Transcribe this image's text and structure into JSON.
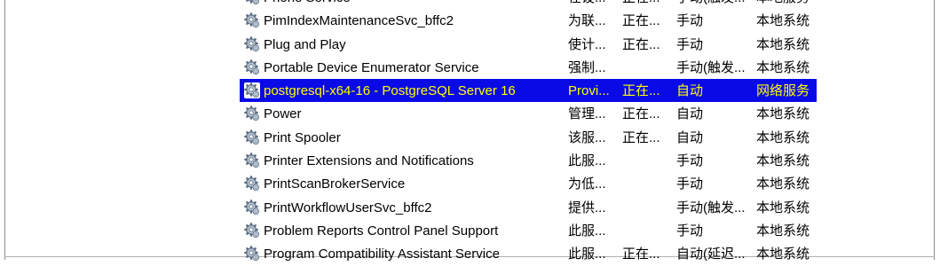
{
  "services": [
    {
      "name": "Phone Service",
      "description": "在设...",
      "status": "正在...",
      "startup": "手动(触发...",
      "logon": "本地服务",
      "selected": false
    },
    {
      "name": "PimIndexMaintenanceSvc_bffc2",
      "description": "为联...",
      "status": "正在...",
      "startup": "手动",
      "logon": "本地系统",
      "selected": false
    },
    {
      "name": "Plug and Play",
      "description": "使计...",
      "status": "正在...",
      "startup": "手动",
      "logon": "本地系统",
      "selected": false
    },
    {
      "name": "Portable Device Enumerator Service",
      "description": "强制...",
      "status": "",
      "startup": "手动(触发...",
      "logon": "本地系统",
      "selected": false
    },
    {
      "name": "postgresql-x64-16 - PostgreSQL Server 16",
      "description": "Provi...",
      "status": "正在...",
      "startup": "自动",
      "logon": "网络服务",
      "selected": true
    },
    {
      "name": "Power",
      "description": "管理...",
      "status": "正在...",
      "startup": "自动",
      "logon": "本地系统",
      "selected": false
    },
    {
      "name": "Print Spooler",
      "description": "该服...",
      "status": "正在...",
      "startup": "自动",
      "logon": "本地系统",
      "selected": false
    },
    {
      "name": "Printer Extensions and Notifications",
      "description": "此服...",
      "status": "",
      "startup": "手动",
      "logon": "本地系统",
      "selected": false
    },
    {
      "name": "PrintScanBrokerService",
      "description": "为低...",
      "status": "",
      "startup": "手动",
      "logon": "本地系统",
      "selected": false
    },
    {
      "name": "PrintWorkflowUserSvc_bffc2",
      "description": "提供...",
      "status": "",
      "startup": "手动(触发...",
      "logon": "本地系统",
      "selected": false
    },
    {
      "name": "Problem Reports Control Panel Support",
      "description": "此服...",
      "status": "",
      "startup": "手动",
      "logon": "本地系统",
      "selected": false
    },
    {
      "name": "Program Compatibility Assistant Service",
      "description": "此服...",
      "status": "正在...",
      "startup": "自动(延迟...",
      "logon": "本地系统",
      "selected": false
    }
  ],
  "icon": "service-gear-icon"
}
